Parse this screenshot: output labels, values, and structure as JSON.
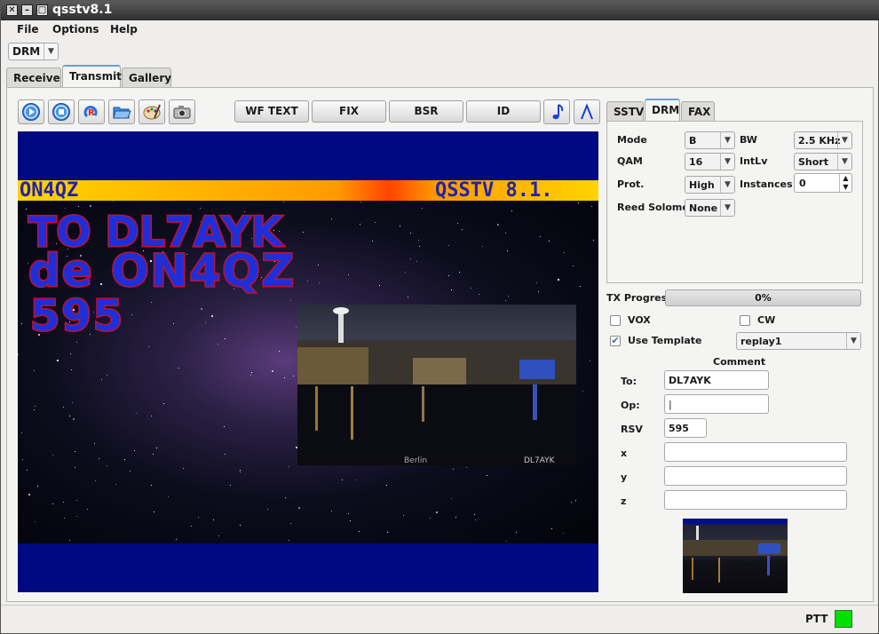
{
  "window": {
    "title": "qsstv8.1"
  },
  "menu": {
    "items": [
      "File",
      "Options",
      "Help"
    ]
  },
  "mode_select": {
    "value": "DRM"
  },
  "main_tabs": [
    {
      "label": "Receive"
    },
    {
      "label": "Transmit"
    },
    {
      "label": "Gallery"
    }
  ],
  "main_tabs_active": "Transmit",
  "toolbar": {
    "icon_buttons": [
      "start-icon",
      "stop-icon",
      "repeat-icon",
      "open-folder-icon",
      "palette-icon",
      "camera-icon"
    ],
    "labeled_buttons": [
      "WF TEXT",
      "FIX",
      "BSR",
      "ID"
    ],
    "extra_icons": [
      "music-note-icon",
      "lambda-icon"
    ]
  },
  "preview": {
    "banner_left": "ON4QZ",
    "banner_right": "QSSTV 8.1.",
    "line1": "TO DL7AYK",
    "line2": "de ON4QZ",
    "line3": "595",
    "photo_caption_left": "Berlin",
    "photo_caption_right": "DL7AYK"
  },
  "right_tabs": [
    {
      "label": "SSTV"
    },
    {
      "label": "DRM"
    },
    {
      "label": "FAX"
    }
  ],
  "right_tabs_active": "DRM",
  "drm": {
    "mode_label": "Mode",
    "mode_value": "B",
    "bw_label": "BW",
    "bw_value": "2.5 KHz",
    "qam_label": "QAM",
    "qam_value": "16",
    "intlv_label": "IntLv",
    "intlv_value": "Short",
    "prot_label": "Prot.",
    "prot_value": "High",
    "instances_label": "Instances",
    "instances_value": "0",
    "rs_label": "Reed Solomon",
    "rs_value": "None"
  },
  "tx": {
    "progress_label": "TX Progress",
    "progress_fraction": 0.0,
    "progress_text": "0%",
    "vox_label": "VOX",
    "vox_checked": false,
    "cw_label": "CW",
    "cw_checked": false,
    "template_label": "Use Template",
    "template_checked": true,
    "template_value": "replay1"
  },
  "comment": {
    "title": "Comment",
    "to_label": "To:",
    "to_value": "DL7AYK",
    "op_label": "Op:",
    "op_value": "|",
    "rsv_label": "RSV",
    "rsv_value": "595",
    "x_label": "x",
    "x_value": "",
    "y_label": "y",
    "y_value": "",
    "z_label": "z",
    "z_value": ""
  },
  "status": {
    "ptt_label": "PTT",
    "ptt_color": "#00e000"
  }
}
